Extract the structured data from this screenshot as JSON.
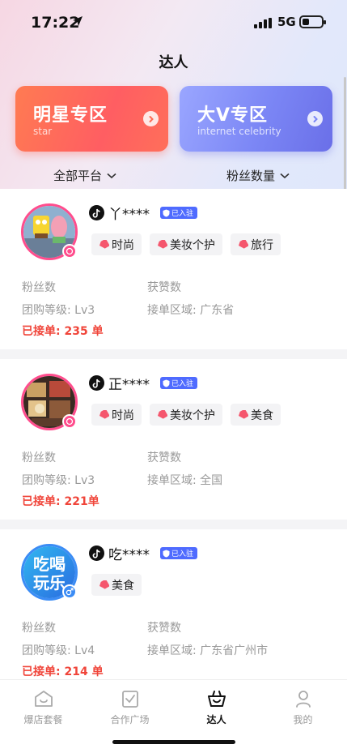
{
  "status_bar": {
    "time": "17:22",
    "network": "5G"
  },
  "page": {
    "title": "达人"
  },
  "zones": [
    {
      "title": "明星专区",
      "subtitle": "star",
      "color": "#ff6a55"
    },
    {
      "title": "大V专区",
      "subtitle": "internet celebrity",
      "color": "#7b86f5"
    }
  ],
  "filters": {
    "platform": "全部平台",
    "fans": "粉丝数量"
  },
  "labels": {
    "fans": "粉丝数",
    "likes": "获赞数",
    "level_prefix": "团购等级: ",
    "region_prefix": "接单区域: ",
    "orders_prefix": "已接单: ",
    "orders_suffix": " 单",
    "settled": "已入驻"
  },
  "influencers": [
    {
      "name": "丫****",
      "tags": [
        "时尚",
        "美妆个护",
        "旅行"
      ],
      "level": "团购等级: Lv3",
      "region": "接单区域: 广东省",
      "orders": "已接单: 235 单",
      "orders_count": 235
    },
    {
      "name": "正****",
      "tags": [
        "时尚",
        "美妆个护",
        "美食"
      ],
      "level": "团购等级: Lv3",
      "region": "接单区域: 全国",
      "orders": "已接单: 221单",
      "orders_count": 221
    },
    {
      "name": "吃****",
      "tags": [
        "美食"
      ],
      "level": "团购等级: Lv4",
      "region": "接单区域: 广东省广州市",
      "orders": "已接单: 214 单",
      "orders_count": 214
    }
  ],
  "avatar_text": {
    "line1": "吃喝",
    "line2": "玩乐"
  },
  "tabbar": [
    {
      "label": "爆店套餐",
      "icon": "shop-icon"
    },
    {
      "label": "合作广场",
      "icon": "clipboard-check-icon"
    },
    {
      "label": "达人",
      "icon": "basket-icon",
      "active": true
    },
    {
      "label": "我的",
      "icon": "person-icon"
    }
  ],
  "colors": {
    "accent_red": "#f0453a",
    "badge_blue": "#4f6bff",
    "avatar_pink": "#ff4d8d"
  }
}
